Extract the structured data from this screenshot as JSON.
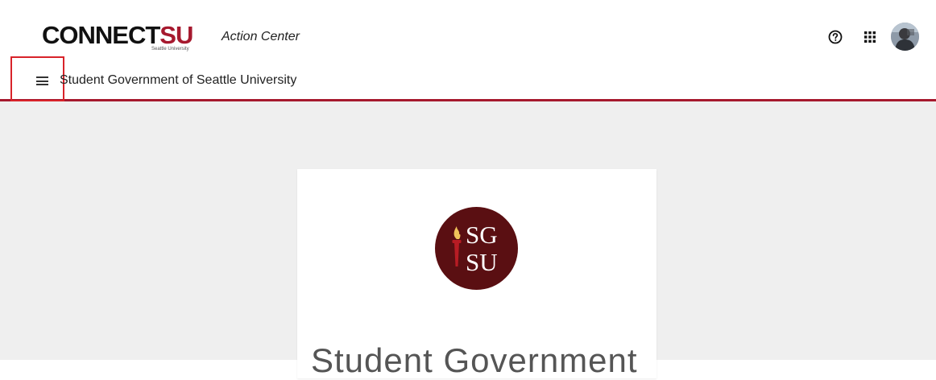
{
  "header": {
    "brand_main": "CONNECT",
    "brand_accent": "SU",
    "brand_sub": "Seattle University",
    "app_name": "Action Center",
    "org_name": "Student Government of Seattle University"
  },
  "icons": {
    "menu": "hamburger-menu-icon",
    "help": "help-icon",
    "apps": "apps-grid-icon",
    "avatar": "user-avatar"
  },
  "card": {
    "logo_line1": "SG",
    "logo_line2": "SU",
    "title": "Student Government"
  },
  "colors": {
    "accent": "#a6192e",
    "logo_bg": "#5a0f12",
    "page_bg": "#efefef"
  }
}
